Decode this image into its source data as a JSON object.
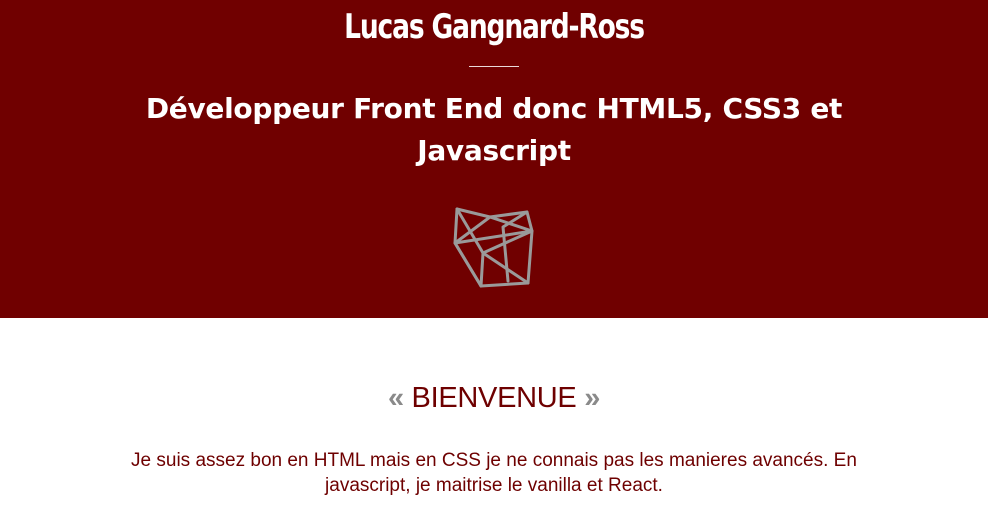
{
  "header": {
    "name": "Lucas Gangnard-Ross",
    "subtitle": "Développeur Front End donc HTML5, CSS3 et Javascript",
    "logo_icon": "polygon-wireframe-icon",
    "background_color": "#700000",
    "logo_color": "#9a9a9a"
  },
  "welcome": {
    "quote_open": "«",
    "title": "BIENVENUE",
    "quote_close": "»",
    "text": "Je suis assez bon en HTML mais en CSS je ne connais pas les manieres avancés. En javascript, je maitrise le vanilla et React.",
    "accent_color": "#6e0000",
    "quote_color": "#8a8a8a"
  }
}
